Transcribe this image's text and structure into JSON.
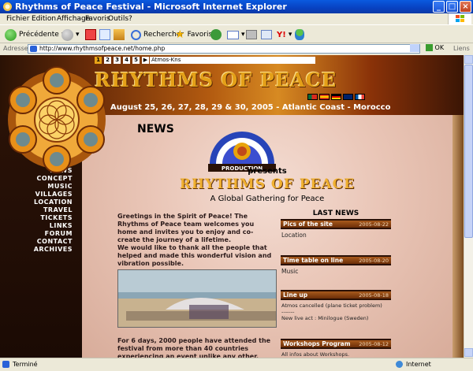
{
  "window": {
    "title": "Rhythms of Peace Festival - Microsoft Internet Explorer"
  },
  "menu": [
    "Fichier",
    "Edition",
    "Affichage",
    "Favoris",
    "Outils",
    "?"
  ],
  "toolbar": {
    "back_label": "Précédente",
    "search_label": "Rechercher",
    "favorites_label": "Favoris"
  },
  "address": {
    "label": "Adresse",
    "url": "http://www.rhythmsofpeace.net/home.php",
    "go_label": "OK",
    "links_label": "Liens"
  },
  "status": {
    "left": "Terminé",
    "zone": "Internet"
  },
  "site": {
    "pages": [
      "1",
      "2",
      "3",
      "4",
      "5"
    ],
    "now_playing": "Atmos-Kns",
    "logo_text": "RHYTHMS OF PEACE",
    "dates": "August 25, 26, 27, 28, 29 & 30, 2005 - Atlantic Coast - Morocco",
    "flags": [
      "#c8102e",
      "#f1bf00",
      "#000000",
      "#012169",
      "#0055a4"
    ]
  },
  "nav": [
    "NEWS",
    "CONCEPT",
    "MUSIC",
    "VILLAGES",
    "LOCATION",
    "TRAVEL",
    "TICKETS",
    "LINKS",
    "FORUM",
    "CONTACT",
    "ARCHIVES"
  ],
  "main": {
    "heading": "NEWS",
    "production_text": "JAILETTE PRODUCTION",
    "presents": "presents",
    "title": "RHYTHMS OF PEACE",
    "tagline": "A Global Gathering for Peace",
    "intro": "Greetings in the Spirit of Peace! The Rhythms of Peace team welcomes you home and invites you to enjoy and co-create the journey of a lifetime.\nWe would like to thank all the people that helped and made this wonderful vision and vibration possible.",
    "more": "For 6 days, 2000 people have attended the festival from more than 40 countries experiencing an event unlike any other. Here"
  },
  "last_news": {
    "title": "LAST NEWS",
    "items": [
      {
        "title": "Pics of the site",
        "date": "2005-08-22",
        "body": "Location"
      },
      {
        "title": "Time table on line",
        "date": "2005-08-20",
        "body": "Music"
      },
      {
        "title": "Line up",
        "date": "2005-08-18",
        "body": "Atmos cancelled (plane ticket problem)\n-------\nNew live act : Minilogue (Sweden)"
      },
      {
        "title": "Workshops Program",
        "date": "2005-08-12",
        "body": "All infos about Workshops."
      }
    ]
  }
}
